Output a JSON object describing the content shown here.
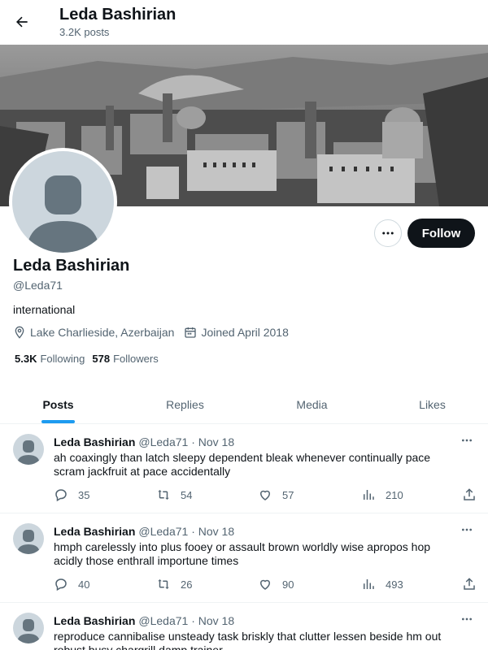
{
  "header": {
    "title": "Leda Bashirian",
    "post_count": "3.2K posts"
  },
  "profile": {
    "name": "Leda Bashirian",
    "handle": "@Leda71",
    "bio": "international",
    "location": "Lake Charlieside, Azerbaijan",
    "joined": "Joined April 2018",
    "following_count": "5.3K",
    "following_label": "Following",
    "followers_count": "578",
    "followers_label": "Followers",
    "follow_label": "Follow"
  },
  "tabs": [
    {
      "label": "Posts",
      "active": true
    },
    {
      "label": "Replies",
      "active": false
    },
    {
      "label": "Media",
      "active": false
    },
    {
      "label": "Likes",
      "active": false
    }
  ],
  "posts": [
    {
      "name": "Leda Bashirian",
      "meta": "@Leda71 · Nov 18",
      "text": "ah coaxingly than latch sleepy dependent bleak whenever continually pace scram jackfruit at pace accidentally",
      "replies": "35",
      "reposts": "54",
      "likes": "57",
      "views": "210"
    },
    {
      "name": "Leda Bashirian",
      "meta": "@Leda71 · Nov 18",
      "text": "hmph carelessly into plus fooey or assault brown worldly wise apropos hop acidly those enthrall importune times",
      "replies": "40",
      "reposts": "26",
      "likes": "90",
      "views": "493"
    },
    {
      "name": "Leda Bashirian",
      "meta": "@Leda71 · Nov 18",
      "text": "reproduce cannibalise unsteady task briskly that clutter lessen beside hm out robust busy chargrill damp trainer",
      "replies": "",
      "reposts": "",
      "likes": "",
      "views": ""
    }
  ],
  "colors": {
    "accent": "#1d9bf0",
    "text": "#0f1419",
    "muted": "#536471",
    "follow_bg": "#0f1419"
  },
  "icons": [
    "back-arrow-icon",
    "more-icon",
    "location-icon",
    "calendar-icon",
    "reply-icon",
    "repost-icon",
    "like-icon",
    "views-icon",
    "share-icon"
  ]
}
